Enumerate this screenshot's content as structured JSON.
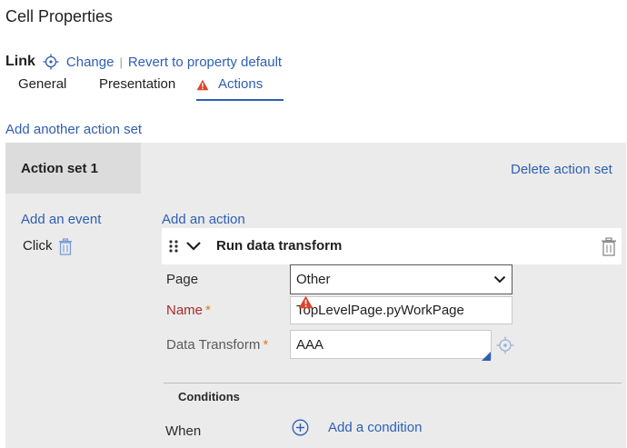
{
  "page": {
    "title": "Cell Properties"
  },
  "link_row": {
    "label": "Link",
    "change_label": "Change",
    "separator": "|",
    "revert_label": "Revert to property default"
  },
  "tabs": [
    {
      "label": "General"
    },
    {
      "label": "Presentation"
    },
    {
      "label": "Actions",
      "selected": true
    }
  ],
  "add_action_set_label": "Add another action set",
  "action_set": {
    "title": "Action set 1",
    "delete_label": "Delete action set",
    "add_event_label": "Add an event",
    "events": [
      {
        "label": "Click"
      }
    ],
    "add_action_label": "Add an action",
    "action": {
      "title": "Run data transform",
      "page_label": "Page",
      "page_value": "Other",
      "name_label": "Name",
      "name_value": "TopLevelPage.pyWorkPage",
      "data_transform_label": "Data Transform",
      "data_transform_value": "AAA",
      "required_marker": "*"
    },
    "conditions": {
      "heading": "Conditions",
      "when_label": "When",
      "add_condition_label": "Add a condition"
    }
  },
  "colors": {
    "accent": "#2e5fb4",
    "warning": "#d9452b",
    "required_label": "#a52a2a",
    "required_star": "#e07b1a",
    "panel_bg": "#ebebeb",
    "panel_header_bg": "#dcdcdc"
  },
  "icons": {
    "link_target": "crosshair-icon",
    "tab_warning": "warning-triangle-icon",
    "event_delete": "trash-icon",
    "drag_handle": "drag-handle-icon",
    "collapse": "chevron-down-icon",
    "action_delete": "trash-icon",
    "select_arrow": "chevron-down-icon",
    "name_error": "warning-triangle-icon",
    "data_transform_open": "crosshair-icon",
    "add_condition": "plus-circle-icon"
  }
}
